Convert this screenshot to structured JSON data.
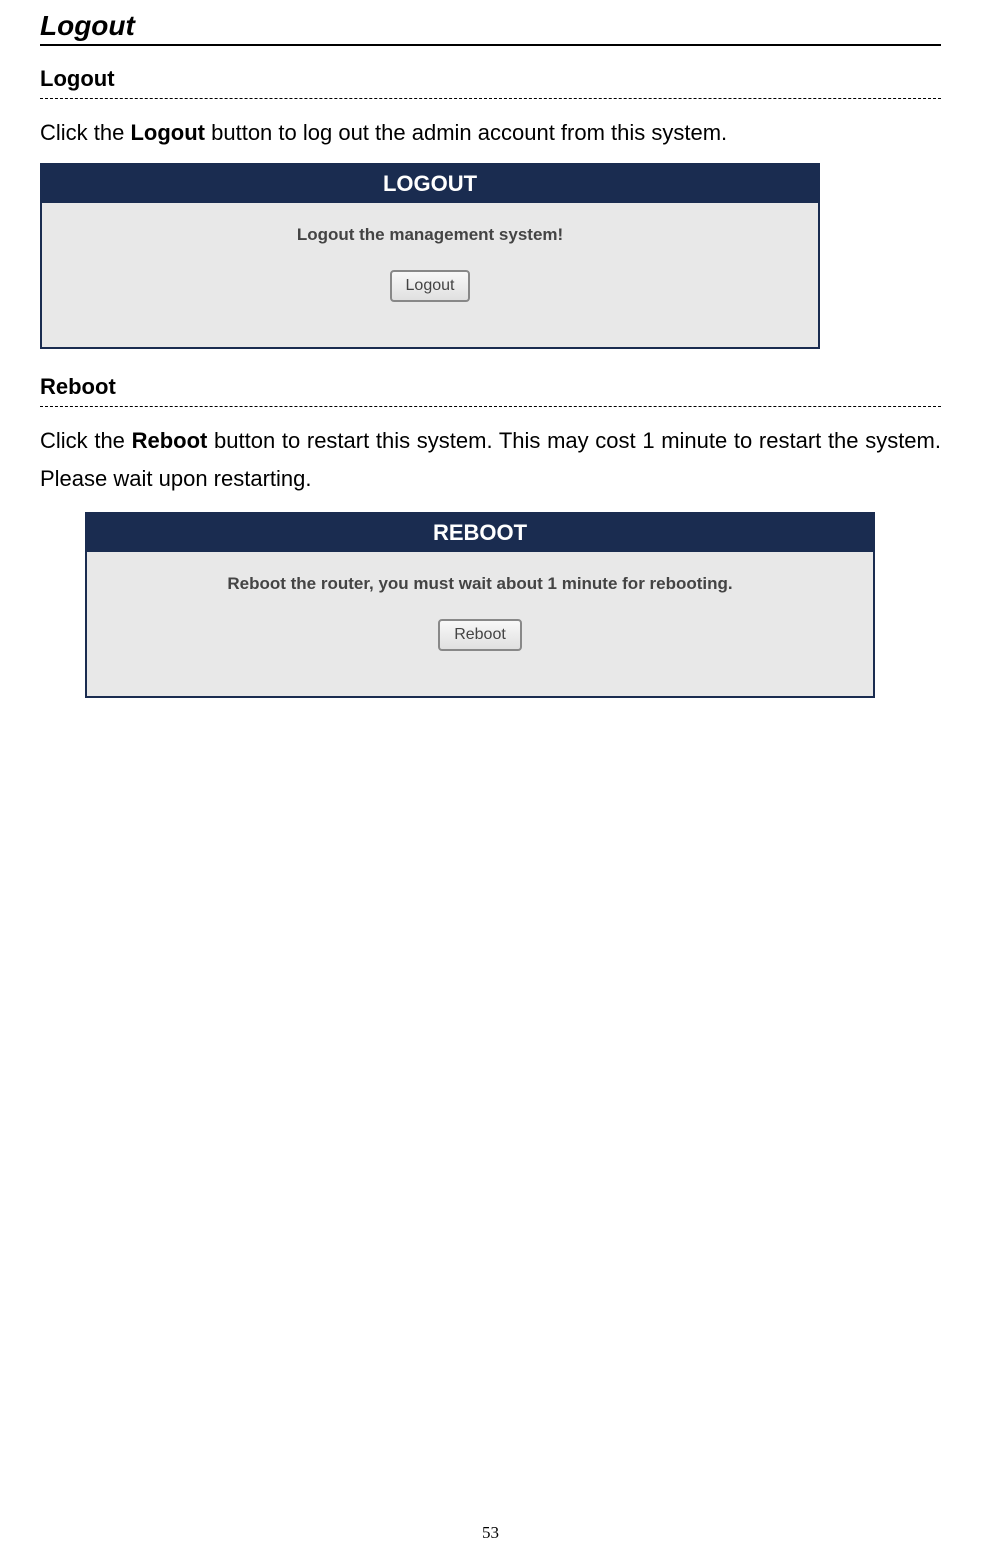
{
  "page": {
    "main_title": "Logout",
    "page_number": "53"
  },
  "sections": {
    "logout": {
      "header": "Logout",
      "desc_prefix": "Click the ",
      "desc_bold": "Logout",
      "desc_suffix": " button to log out the admin account from this system.",
      "panel_title": "LOGOUT",
      "panel_message": "Logout the management system!",
      "button_label": "Logout"
    },
    "reboot": {
      "header": "Reboot",
      "desc_prefix": "Click the ",
      "desc_bold": "Reboot",
      "desc_suffix": " button to restart this system. This may cost 1 minute to restart the system. Please wait upon restarting.",
      "panel_title": "REBOOT",
      "panel_message": "Reboot the router, you must wait about 1 minute for rebooting.",
      "button_label": "Reboot"
    }
  }
}
